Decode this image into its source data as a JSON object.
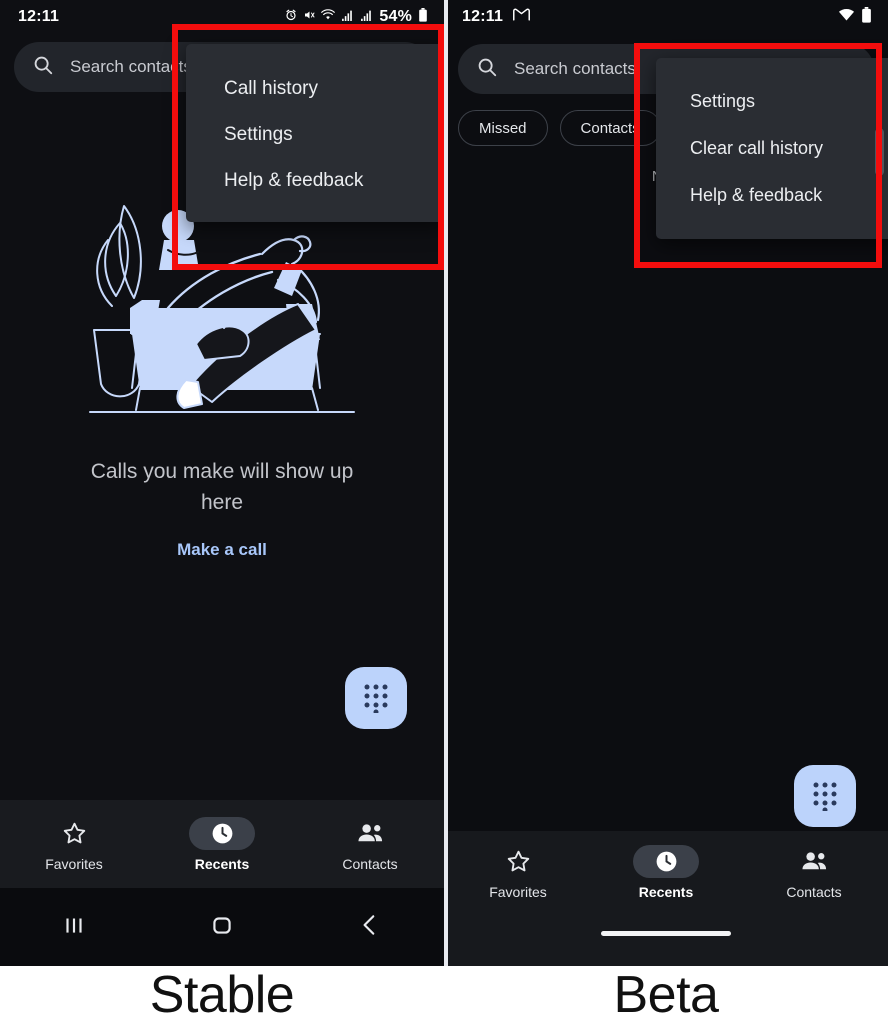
{
  "comparison": {
    "left_caption": "Stable",
    "right_caption": "Beta"
  },
  "stable": {
    "statusbar": {
      "time": "12:11",
      "battery_percent": "54%",
      "icons": [
        "alarm-icon",
        "mute-icon",
        "wifi-icon",
        "signal-icon",
        "signal-icon",
        "battery-icon"
      ]
    },
    "search": {
      "placeholder": "Search contacts",
      "icon": "search-icon"
    },
    "empty_state": {
      "title": "Calls you make will show up here",
      "link": "Make a call",
      "illustration": "person-on-couch-illustration"
    },
    "fab": {
      "icon": "dialpad-icon"
    },
    "menu": {
      "items": [
        {
          "label": "Call history"
        },
        {
          "label": "Settings"
        },
        {
          "label": "Help & feedback"
        }
      ]
    },
    "bottomnav": [
      {
        "label": "Favorites",
        "icon": "star-icon",
        "active": false
      },
      {
        "label": "Recents",
        "icon": "clock-icon",
        "active": true
      },
      {
        "label": "Contacts",
        "icon": "people-icon",
        "active": false
      }
    ],
    "sysnav": {
      "type": "three-button",
      "items": [
        "recents-button",
        "home-button",
        "back-button"
      ]
    }
  },
  "beta": {
    "statusbar": {
      "time": "12:11",
      "icons": [
        "gmail-icon",
        "wifi-icon",
        "battery-icon"
      ]
    },
    "search": {
      "placeholder": "Search contacts",
      "icon": "search-icon"
    },
    "chips": [
      {
        "label": ""
      },
      {
        "label": "Missed"
      },
      {
        "label": "Contacts"
      }
    ],
    "empty_text": "No r",
    "fab": {
      "icon": "dialpad-icon"
    },
    "menu": {
      "items": [
        {
          "label": "Settings"
        },
        {
          "label": "Clear call history"
        },
        {
          "label": "Help & feedback"
        }
      ]
    },
    "bottomnav": [
      {
        "label": "Favorites",
        "icon": "star-icon",
        "active": false
      },
      {
        "label": "Recents",
        "icon": "clock-icon",
        "active": true
      },
      {
        "label": "Contacts",
        "icon": "people-icon",
        "active": false
      }
    ],
    "sysnav": {
      "type": "gesture-pill"
    }
  },
  "colors": {
    "highlight": "#f30d0d",
    "accent_blue": "#a8c7fa",
    "fab_blue": "#bcd3fb",
    "menu_bg": "#2a2d33",
    "phone_bg": "#0e0f13"
  }
}
